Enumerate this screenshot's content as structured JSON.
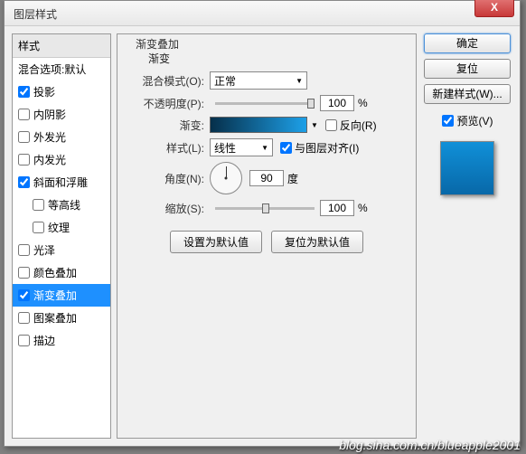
{
  "title": "图层样式",
  "close_x": "X",
  "sidebar": {
    "header": "样式",
    "blend_default": "混合选项:默认",
    "items": [
      {
        "label": "投影",
        "checked": true,
        "indent": false
      },
      {
        "label": "内阴影",
        "checked": false,
        "indent": false
      },
      {
        "label": "外发光",
        "checked": false,
        "indent": false
      },
      {
        "label": "内发光",
        "checked": false,
        "indent": false
      },
      {
        "label": "斜面和浮雕",
        "checked": true,
        "indent": false
      },
      {
        "label": "等高线",
        "checked": false,
        "indent": true
      },
      {
        "label": "纹理",
        "checked": false,
        "indent": true
      },
      {
        "label": "光泽",
        "checked": false,
        "indent": false
      },
      {
        "label": "颜色叠加",
        "checked": false,
        "indent": false
      },
      {
        "label": "渐变叠加",
        "checked": true,
        "indent": false,
        "selected": true
      },
      {
        "label": "图案叠加",
        "checked": false,
        "indent": false
      },
      {
        "label": "描边",
        "checked": false,
        "indent": false
      }
    ]
  },
  "main": {
    "group": "渐变叠加",
    "section": "渐变",
    "blend_mode_label": "混合模式(O):",
    "blend_mode_value": "正常",
    "opacity_label": "不透明度(P):",
    "opacity_value": "100",
    "percent": "%",
    "gradient_label": "渐变:",
    "reverse_label": "反向(R)",
    "style_label": "样式(L):",
    "style_value": "线性",
    "align_label": "与图层对齐(I)",
    "angle_label": "角度(N):",
    "angle_value": "90",
    "degree": "度",
    "scale_label": "缩放(S):",
    "scale_value": "100",
    "set_default": "设置为默认值",
    "reset_default": "复位为默认值"
  },
  "right": {
    "ok": "确定",
    "cancel": "复位",
    "new_style": "新建样式(W)...",
    "preview": "预览(V)"
  },
  "watermark": "blog.sina.com.cn/blueapple2001"
}
